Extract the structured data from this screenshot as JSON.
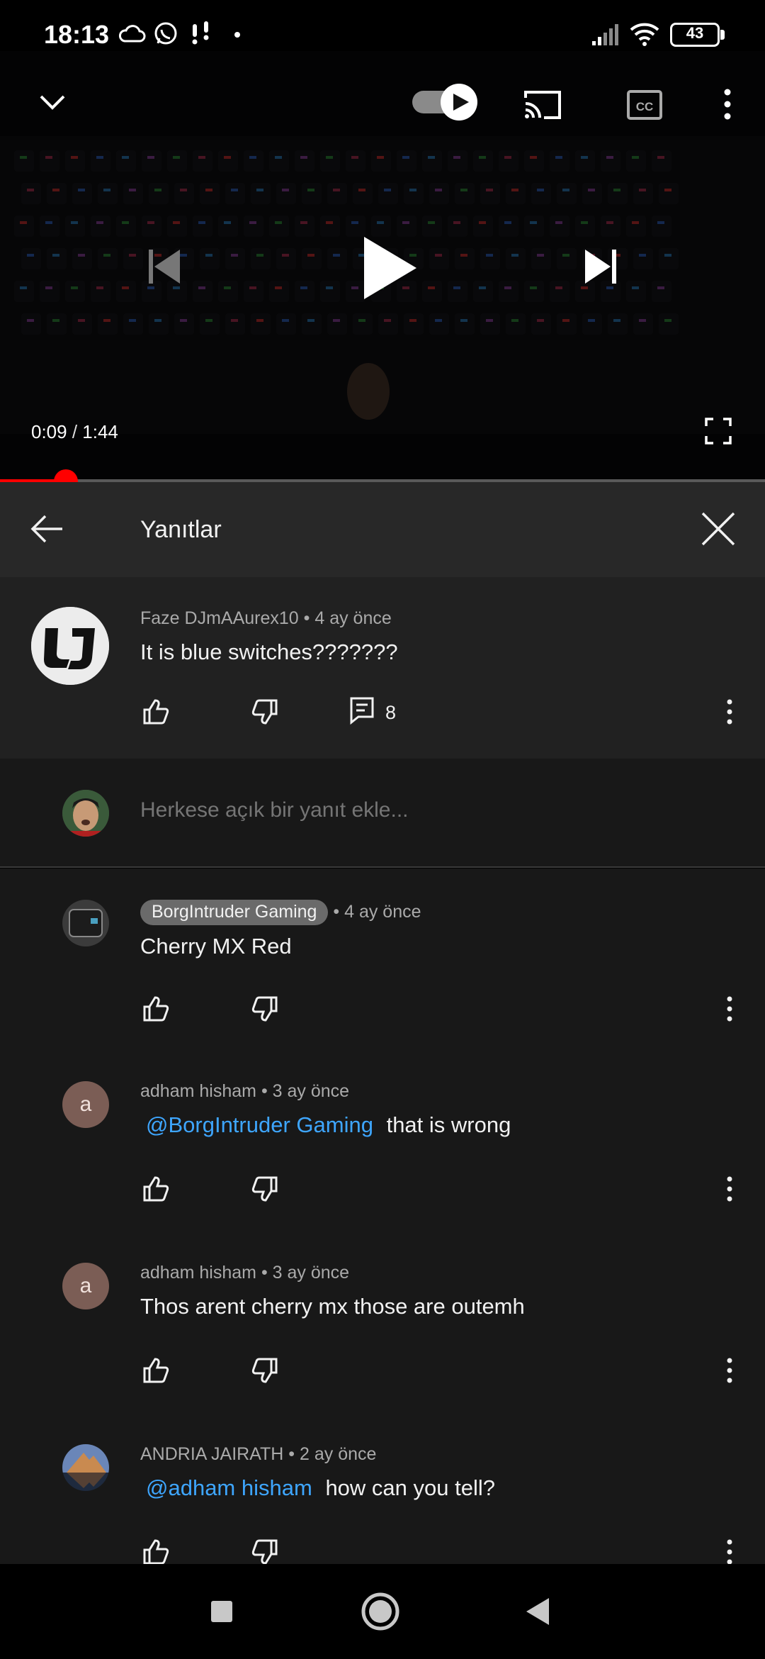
{
  "status_bar": {
    "time": "18:13",
    "battery": "43",
    "icons": [
      "cloud-icon",
      "whatsapp-icon",
      "notification-icon",
      "dot-icon",
      "signal-icon",
      "wifi-icon",
      "battery-icon"
    ]
  },
  "player": {
    "current_time": "0:09",
    "separator": " / ",
    "duration": "1:44",
    "progress_fraction": 0.086,
    "autoplay_on": true,
    "icons": [
      "collapse-chevron-icon",
      "autoplay-toggle-icon",
      "cast-icon",
      "captions-icon",
      "more-vert-icon",
      "previous-icon",
      "play-icon",
      "next-icon",
      "fullscreen-icon"
    ]
  },
  "replies_header": {
    "title": "Yanıtlar",
    "icons": [
      "back-arrow-icon",
      "close-icon"
    ]
  },
  "main_comment": {
    "author": "Faze DJmAAurex10",
    "time": "• 4 ay önce",
    "text": "It is blue switches???????",
    "reply_count": "8"
  },
  "reply_input": {
    "placeholder": "Herkese açık bir yanıt ekle..."
  },
  "replies": [
    {
      "author": "BorgIntruder Gaming",
      "author_is_creator": true,
      "time": "• 4 ay önce",
      "mention": "",
      "text": "Cherry MX Red",
      "avatar": "image"
    },
    {
      "author": "adham hisham",
      "author_is_creator": false,
      "time": "• 3 ay önce",
      "mention": "@BorgIntruder Gaming",
      "text": "that is wrong",
      "avatar": "a"
    },
    {
      "author": "adham hisham",
      "author_is_creator": false,
      "time": "• 3 ay önce",
      "mention": "",
      "text": "Thos arent cherry mx those are outemh",
      "avatar": "a"
    },
    {
      "author": "ANDRIA JAIRATH",
      "author_is_creator": false,
      "time": "• 2 ay önce",
      "mention": "@adham hisham",
      "text": "how can you tell?",
      "avatar": "image"
    }
  ],
  "nav_bar": {
    "icons": [
      "recents-square-icon",
      "home-circle-icon",
      "back-triangle-icon"
    ]
  },
  "colors": {
    "accent_red": "#ff0000",
    "mention_blue": "#3ea6ff",
    "header_bg": "#282828",
    "comment_bg": "#212121",
    "list_bg": "#181818"
  }
}
